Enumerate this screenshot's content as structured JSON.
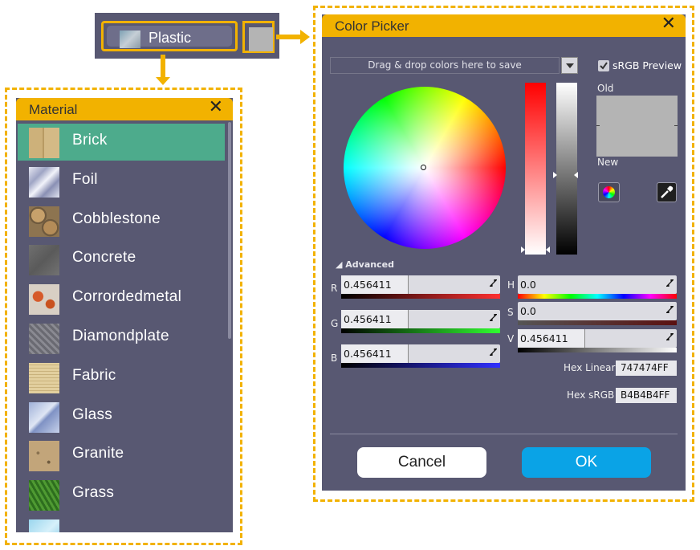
{
  "material_selector": {
    "current": "Plastic",
    "swatch_color": "#b4b4b4"
  },
  "material_panel": {
    "title": "Material",
    "close": "✕",
    "selected_index": 0,
    "selected_color": "#4dab8c",
    "items": [
      {
        "label": "Brick",
        "texture": "brick-texture-icon"
      },
      {
        "label": "Foil",
        "texture": "foil-texture-icon"
      },
      {
        "label": "Cobblestone",
        "texture": "cobblestone-texture-icon"
      },
      {
        "label": "Concrete",
        "texture": "concrete-texture-icon"
      },
      {
        "label": "Corrordedmetal",
        "texture": "corroded-metal-texture-icon"
      },
      {
        "label": "Diamondplate",
        "texture": "diamondplate-texture-icon"
      },
      {
        "label": "Fabric",
        "texture": "fabric-texture-icon"
      },
      {
        "label": "Glass",
        "texture": "glass-texture-icon"
      },
      {
        "label": "Granite",
        "texture": "granite-texture-icon"
      },
      {
        "label": "Grass",
        "texture": "grass-texture-icon"
      }
    ]
  },
  "color_picker": {
    "title": "Color Picker",
    "close": "✕",
    "drop_zone": "Drag & drop colors here to save",
    "srgb_preview_label": "sRGB Preview",
    "srgb_preview_checked": true,
    "old_label": "Old",
    "new_label": "New",
    "old_color": "#b4b4b4",
    "new_color": "#b4b4b4",
    "advanced_label": "Advanced",
    "channels": {
      "r": {
        "label": "R",
        "value": "0.456411",
        "level": 0.456411
      },
      "g": {
        "label": "G",
        "value": "0.456411",
        "level": 0.456411
      },
      "b": {
        "label": "B",
        "value": "0.456411",
        "level": 0.456411
      },
      "h": {
        "label": "H",
        "value": "0.0"
      },
      "s": {
        "label": "S",
        "value": "0.0"
      },
      "v": {
        "label": "V",
        "value": "0.456411",
        "level": 0.456411
      }
    },
    "hex_linear_label": "Hex Linear",
    "hex_linear": "747474FF",
    "hex_srgb_label": "Hex sRGB",
    "hex_srgb": "B4B4B4FF",
    "cancel_label": "Cancel",
    "ok_label": "OK",
    "accent_color": "#f2b200",
    "ok_color": "#0aa3e6"
  }
}
